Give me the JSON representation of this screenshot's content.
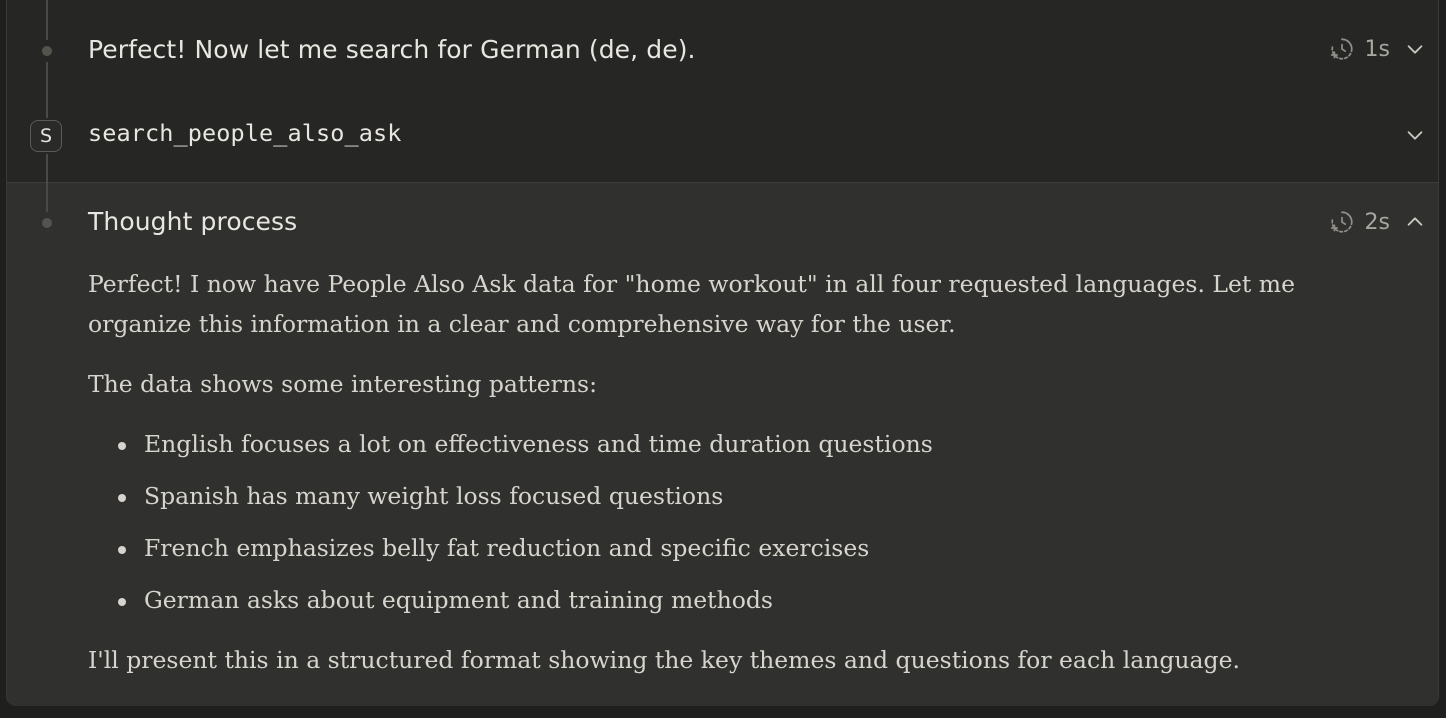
{
  "steps": [
    {
      "title": "Perfect! Now let me search for German (de, de).",
      "duration": "1s",
      "expanded": false
    },
    {
      "badge": "S",
      "title": "search_people_also_ask",
      "expanded": false
    },
    {
      "title": "Thought process",
      "duration": "2s",
      "expanded": true
    }
  ],
  "thought": {
    "intro": "Perfect! I now have People Also Ask data for \"home workout\" in all four requested languages. Let me organize this information in a clear and comprehensive way for the user.",
    "patterns_heading": "The data shows some interesting patterns:",
    "bullets": [
      "English focuses a lot on effectiveness and time duration questions",
      "Spanish has many weight loss focused questions",
      "French emphasizes belly fat reduction and specific exercises",
      "German asks about equipment and training methods"
    ],
    "closing": "I'll present this in a structured format showing the key themes and questions for each language."
  },
  "icons": {
    "duration": "timer-icon",
    "collapse": "chevron-up-icon",
    "expand": "chevron-down-icon"
  }
}
